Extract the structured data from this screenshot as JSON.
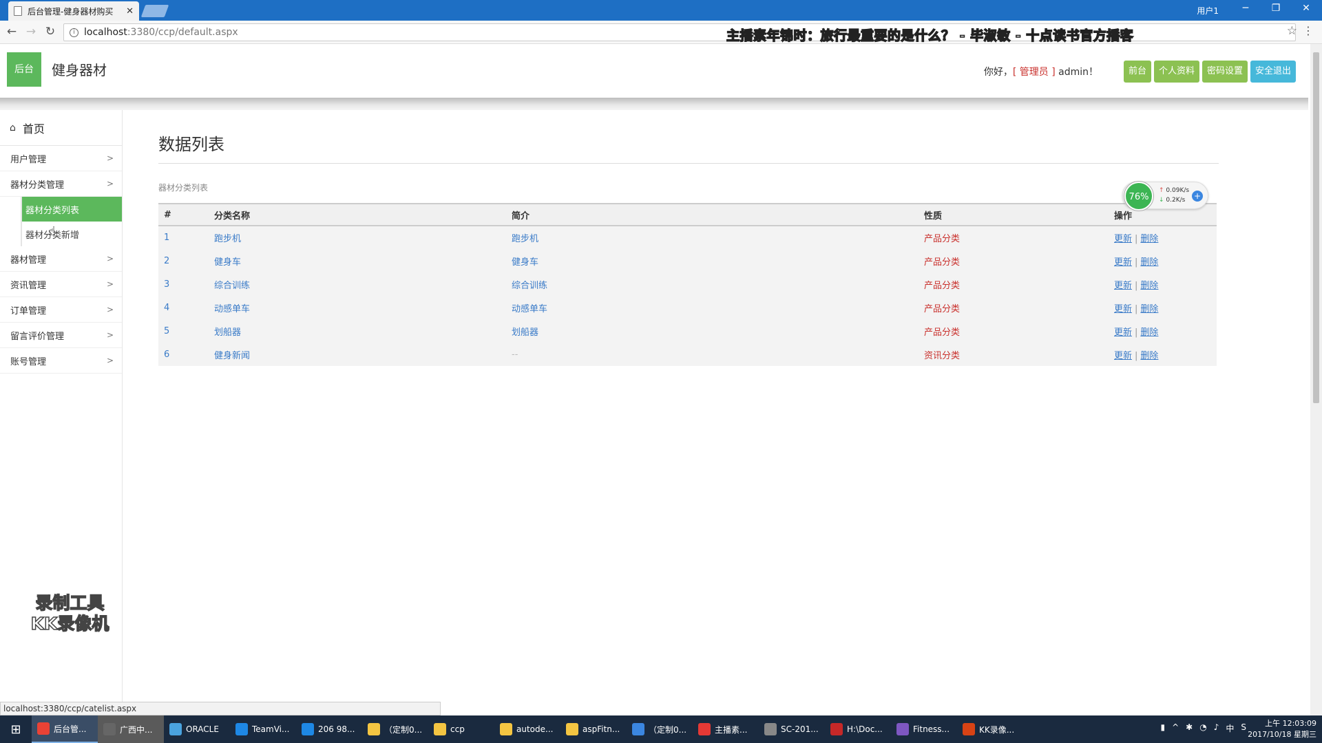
{
  "browser": {
    "tab_title": "后台管理-健身器材购买",
    "url_host": "localhost",
    "url_path": ":3380/ccp/default.aspx",
    "window_user": "用户1",
    "overlay_title": "主播素年锦时：旅行最重要的是什么？ - 毕淑敏 - 十点读书官方播客"
  },
  "header": {
    "logo_text": "后台",
    "site_name": "健身器材",
    "greeting_prefix": "你好，",
    "greeting_role": "[ 管理员 ]",
    "greeting_user": " admin！",
    "buttons": [
      "前台",
      "个人资料",
      "密码设置",
      "安全退出"
    ]
  },
  "sidebar": {
    "home_label": "首页",
    "items": [
      {
        "label": "用户管理",
        "chevron": ">"
      },
      {
        "label": "器材分类管理",
        "chevron": ">"
      },
      {
        "label": "器材管理",
        "chevron": ">"
      },
      {
        "label": "资讯管理",
        "chevron": ">"
      },
      {
        "label": "订单管理",
        "chevron": ">"
      },
      {
        "label": "留言评价管理",
        "chevron": ">"
      },
      {
        "label": "账号管理",
        "chevron": ">"
      }
    ],
    "submenu": [
      "器材分类列表",
      "器材分类新增"
    ]
  },
  "main": {
    "page_title": "数据列表",
    "subtitle": "器材分类列表",
    "columns": [
      "#",
      "分类名称",
      "简介",
      "性质",
      "操作"
    ],
    "rows": [
      {
        "id": "1",
        "name": "跑步机",
        "desc": "跑步机",
        "nature": "产品分类"
      },
      {
        "id": "2",
        "name": "健身车",
        "desc": "健身车",
        "nature": "产品分类"
      },
      {
        "id": "3",
        "name": "综合训练",
        "desc": "综合训练",
        "nature": "产品分类"
      },
      {
        "id": "4",
        "name": "动感单车",
        "desc": "动感单车",
        "nature": "产品分类"
      },
      {
        "id": "5",
        "name": "划船器",
        "desc": "划船器",
        "nature": "产品分类"
      },
      {
        "id": "6",
        "name": "健身新闻",
        "desc": "--",
        "nature": "资讯分类"
      }
    ],
    "action_update": "更新",
    "action_separator": "|",
    "action_delete": "删除"
  },
  "net_widget": {
    "percent": "76%",
    "up": "0.09K/s",
    "down": "0.2K/s"
  },
  "watermark": [
    "录制工具",
    "KK录像机"
  ],
  "statusbar": {
    "url": "localhost:3380/ccp/catelist.aspx"
  },
  "taskbar": {
    "tasks": [
      "后台管...",
      "广西中...",
      "ORACLE",
      "TeamVi...",
      "206 98...",
      "（定制0...",
      "ccp",
      "autode...",
      "aspFitn...",
      "（定制0...",
      "主播素...",
      "SC-201...",
      "H:\\Doc...",
      "Fitness...",
      "KK录像..."
    ],
    "tray_ime": "中",
    "time": "上午 12:03:09",
    "date": "2017/10/18 星期三"
  },
  "colors": {
    "accent_green": "#5cb85c",
    "button_green": "#8cc152",
    "button_blue": "#46b8da",
    "link_blue": "#3a7bc8",
    "nature_red": "#c9302c"
  }
}
